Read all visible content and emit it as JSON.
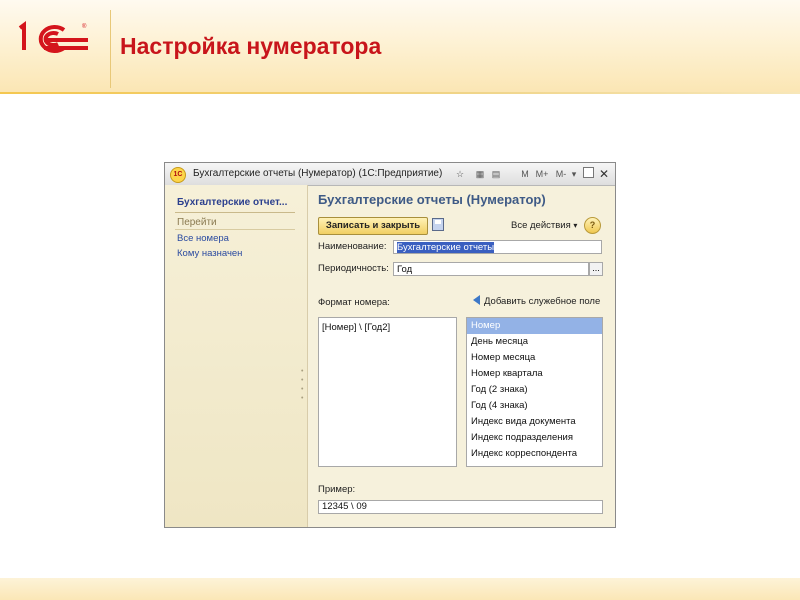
{
  "slide": {
    "title": "Настройка нумератора",
    "logo_text": "1С",
    "accent_color": "#c8151b"
  },
  "window": {
    "title": "Бухгалтерские отчеты (Нумератор)  (1С:Предприятие)",
    "app_icon": "1С",
    "toolbar_m_labels": [
      "M",
      "M+",
      "M-"
    ]
  },
  "nav": {
    "title": "Бухгалтерские отчет...",
    "section": "Перейти",
    "links": [
      "Все номера",
      "Кому назначен"
    ]
  },
  "form": {
    "title": "Бухгалтерские отчеты (Нумератор)",
    "write_close_label": "Записать и закрыть",
    "all_actions_label": "Все действия",
    "help_label": "?",
    "name_label": "Наименование:",
    "name_value": "Бухгалтерские отчеты",
    "period_label": "Периодичность:",
    "period_value": "Год",
    "ellipsis_label": "...",
    "format_label": "Формат номера:",
    "format_value": "[Номер] \\ [Год2]",
    "add_field_label": "Добавить служебное поле",
    "fields": [
      "Номер",
      "День месяца",
      "Номер месяца",
      "Номер квартала",
      "Год (2 знака)",
      "Год (4 знака)",
      "Индекс вида документа",
      "Индекс подразделения",
      "Индекс корреспондента"
    ],
    "selected_field": "Номер",
    "example_label": "Пример:",
    "example_value": "12345 \\ 09"
  }
}
